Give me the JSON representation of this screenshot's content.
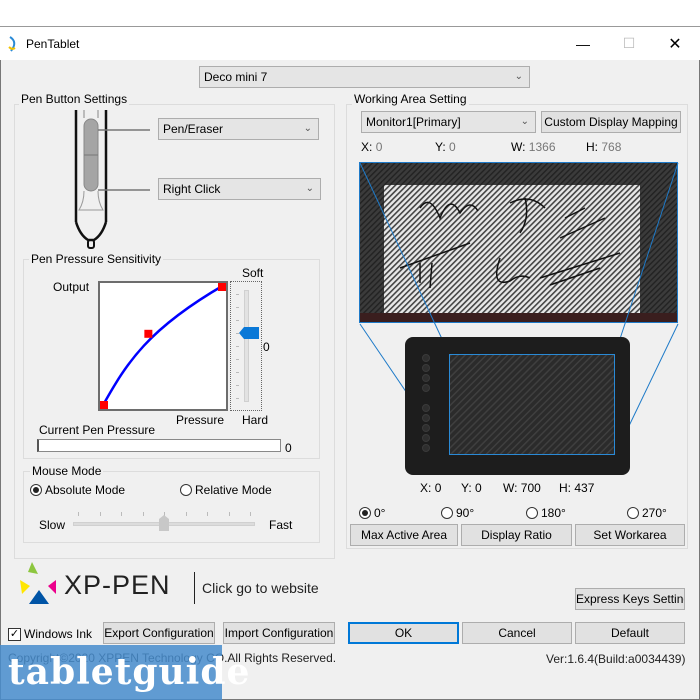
{
  "window": {
    "title": "PenTablet",
    "controls": {
      "minimize": "—",
      "maximize": "☐",
      "close": "✕"
    }
  },
  "device_select": {
    "value": "Deco mini 7"
  },
  "pen_buttons": {
    "group_label": "Pen Button Settings",
    "upper_button": "Pen/Eraser",
    "lower_button": "Right Click"
  },
  "pressure": {
    "group_label": "Pen Pressure Sensitivity",
    "output_label": "Output",
    "pressure_label": "Pressure",
    "soft_label": "Soft",
    "hard_label": "Hard",
    "slider_value": "0",
    "current_label": "Current Pen Pressure",
    "current_value": "0",
    "current_fraction": 0,
    "curve_points": [
      [
        0,
        0
      ],
      [
        0.38,
        0.6
      ],
      [
        1,
        1
      ]
    ],
    "curve_color": "#0000ff",
    "point_color": "#ff0000"
  },
  "mouse_mode": {
    "group_label": "Mouse Mode",
    "absolute_label": "Absolute Mode",
    "relative_label": "Relative Mode",
    "selected": "absolute",
    "slow_label": "Slow",
    "fast_label": "Fast",
    "speed_fraction": 0.5
  },
  "working_area": {
    "group_label": "Working Area Setting",
    "monitor_select": "Monitor1[Primary]",
    "custom_mapping_label": "Custom Display Mapping",
    "screen": {
      "x_label": "X:",
      "x": "0",
      "y_label": "Y:",
      "y": "0",
      "w_label": "W:",
      "w": "1366",
      "h_label": "H:",
      "h": "768"
    },
    "tablet": {
      "x_label": "X:",
      "x": "0",
      "y_label": "Y:",
      "y": "0",
      "w_label": "W:",
      "w": "700",
      "h_label": "H:",
      "h": "437"
    },
    "rotations": [
      "0°",
      "90°",
      "180°",
      "270°"
    ],
    "rotation_selected": "0°",
    "max_active_label": "Max Active Area",
    "display_ratio_label": "Display Ratio",
    "set_workarea_label": "Set Workarea",
    "accent": "#1e7ac8"
  },
  "brand": {
    "logo_text": "XP-PEN",
    "website_link": "Click go to website"
  },
  "footer": {
    "express_keys_label": "Express Keys Setting",
    "windows_ink_label": "Windows Ink",
    "windows_ink_checked": true,
    "export_label": "Export Configuration",
    "import_label": "Import Configuration",
    "ok_label": "OK",
    "cancel_label": "Cancel",
    "default_label": "Default",
    "copyright": "Copyright©2020 XPPEN Technology CO.All Rights Reserved.",
    "version": "Ver:1.6.4(Build:a0034439)"
  },
  "watermark": {
    "text": "tabletguide"
  }
}
